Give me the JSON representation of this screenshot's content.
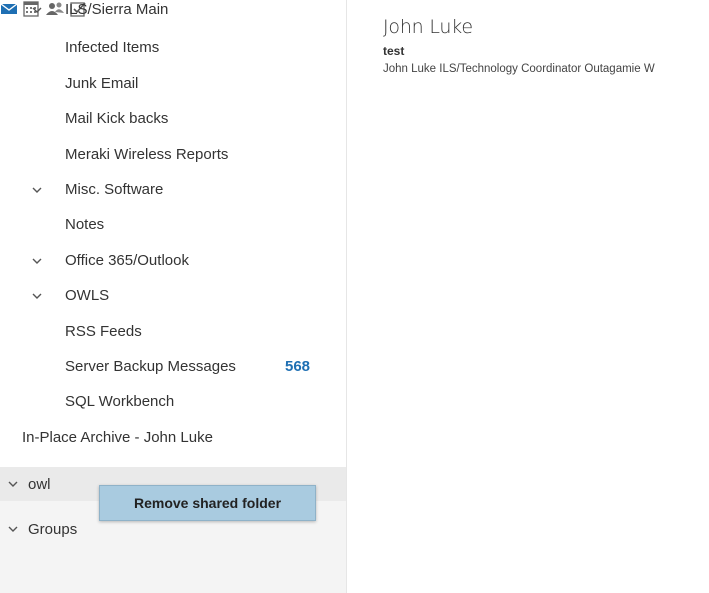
{
  "folders": {
    "ils_sierra_main": "ILS/Sierra Main",
    "infected_items": "Infected Items",
    "junk_email": "Junk Email",
    "mail_kick_backs": "Mail Kick backs",
    "meraki_wireless_reports": "Meraki Wireless Reports",
    "misc_software": "Misc. Software",
    "notes": "Notes",
    "office_365_outlook": "Office 365/Outlook",
    "owls": "OWLS",
    "rss_feeds": "RSS Feeds",
    "server_backup_messages": "Server Backup Messages",
    "server_backup_count": "568",
    "sql_workbench": "SQL Workbench",
    "in_place_archive": "In-Place Archive - John Luke",
    "owl": "owl",
    "groups": "Groups"
  },
  "context_menu": {
    "remove_shared_folder": "Remove shared folder"
  },
  "bottom_nav": {
    "icons": [
      "mail-icon",
      "calendar-icon",
      "people-icon",
      "tasks-icon"
    ],
    "active_color": "#1e6fb3"
  },
  "reading_pane": {
    "sender": "John Luke",
    "subject": "test",
    "preview": "John Luke ILS/Technology Coordinator Outagamie W"
  },
  "colors": {
    "accent": "#1e6fb3",
    "context_menu_bg": "#a9cbe0"
  }
}
